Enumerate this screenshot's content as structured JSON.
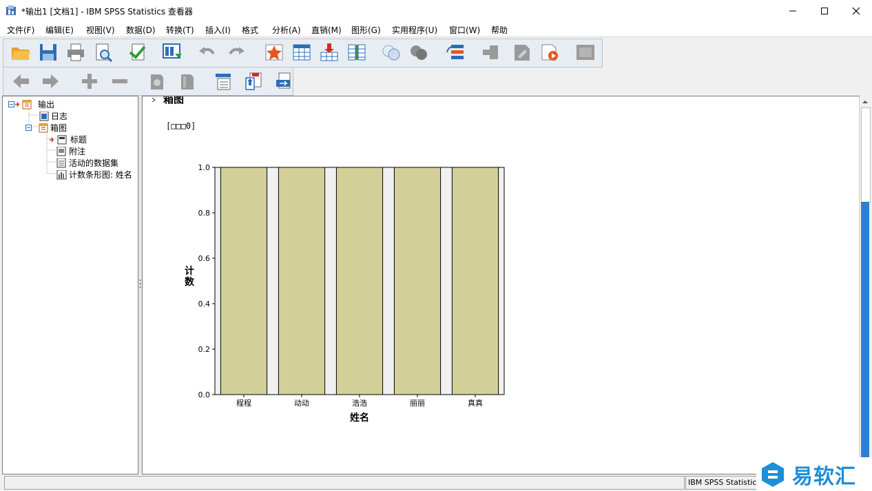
{
  "window": {
    "title": "*输出1 [文档1] - IBM SPSS Statistics 查看器",
    "controls": [
      "minimize",
      "maximize",
      "close"
    ]
  },
  "menu": {
    "items": [
      "文件(F)",
      "编辑(E)",
      "视图(V)",
      "数据(D)",
      "转换(T)",
      "插入(I)",
      "格式",
      "分析(A)",
      "直销(M)",
      "图形(G)",
      "实用程序(U)",
      "窗口(W)",
      "帮助"
    ]
  },
  "toolbar1": {
    "icons": [
      "open-folder-icon",
      "save-icon",
      "print-icon",
      "print-preview-icon",
      "export-icon",
      "recall-dialog-icon",
      "undo-icon",
      "redo-icon",
      "goto-case-icon",
      "goto-variable-icon",
      "insert-cases-icon",
      "insert-variable-icon",
      "venn-icon",
      "venn-filled-icon",
      "value-labels-icon",
      "designate-window-icon",
      "syntax-icon",
      "run-script-icon",
      "frame-icon"
    ]
  },
  "toolbar2": {
    "icons": [
      "back-arrow-icon",
      "forward-arrow-icon",
      "expand-icon",
      "collapse-icon",
      "show-icon",
      "hide-icon",
      "insert-heading-icon",
      "insert-title-icon",
      "insert-text-icon"
    ]
  },
  "outline": {
    "nodes": [
      {
        "label": "输出"
      },
      {
        "label": "日志"
      },
      {
        "label": "箱图"
      },
      {
        "label": "标题"
      },
      {
        "label": "附注"
      },
      {
        "label": "活动的数据集"
      },
      {
        "label": "计数条形图: 姓名"
      }
    ]
  },
  "content": {
    "heading": "箱图",
    "dataset_label": "[□□□0]"
  },
  "chart_data": {
    "type": "bar",
    "categories": [
      "程程",
      "动动",
      "浩浩",
      "丽丽",
      "真真"
    ],
    "values": [
      1.0,
      1.0,
      1.0,
      1.0,
      1.0
    ],
    "xlabel": "姓名",
    "ylabel": "计数",
    "ylim": [
      0,
      1.0
    ],
    "yticks": [
      "0.0",
      "0.2",
      "0.4",
      "0.6",
      "0.8",
      "1.0"
    ],
    "bar_color": "#d3cf99",
    "plot_background": "#f0f0f0",
    "grid": false
  },
  "status": {
    "right_text": "IBM SPSS Statistics"
  },
  "watermark": {
    "text": "易软汇"
  }
}
